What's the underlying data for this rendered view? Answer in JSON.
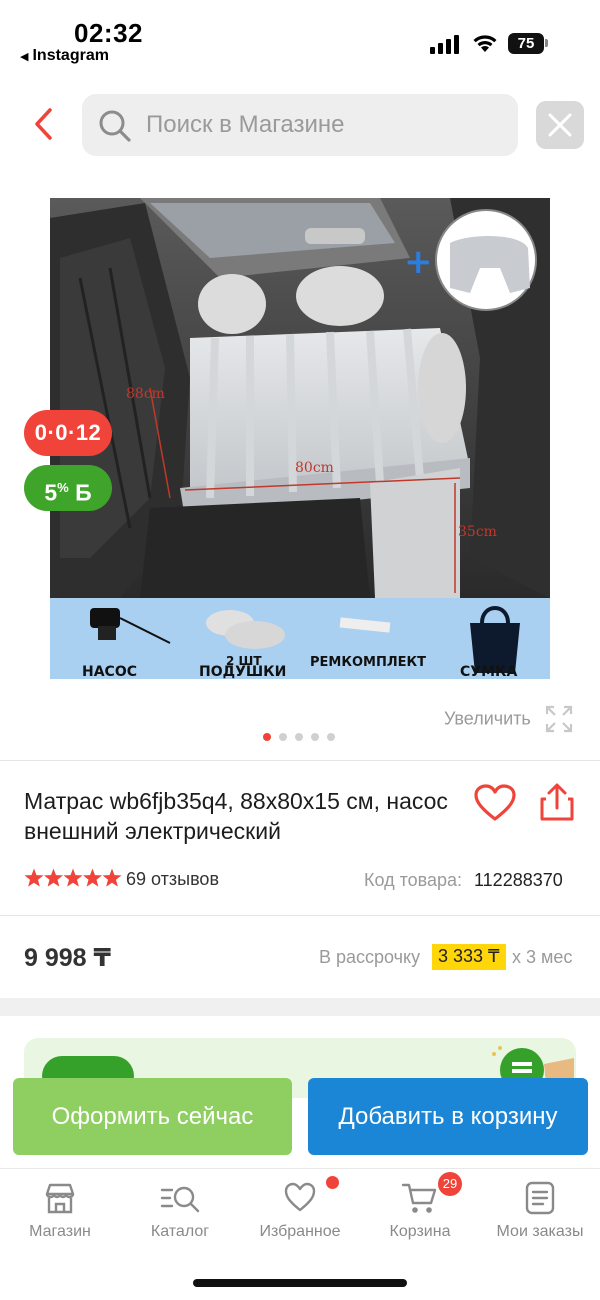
{
  "status_bar": {
    "time": "02:32",
    "back_app": "Instagram",
    "battery": "75"
  },
  "search": {
    "placeholder": "Поиск в Магазине"
  },
  "product": {
    "image_labels": {
      "dim_height": "88cm",
      "dim_width": "80cm",
      "dim_depth": "35cm",
      "item_pump": "НАСОС",
      "item_pillows_1": "2 ШТ",
      "item_pillows_2": "ПОДУШКИ",
      "item_repair": "РЕМКОМПЛЕКТ",
      "item_bag": "СУМКА"
    },
    "badge_installment": "0·0·12",
    "badge_bonus_pct": "5",
    "badge_bonus_sign": "%",
    "badge_bonus_cur": "Б",
    "zoom_label": "Увеличить",
    "title": "Матрас wb6fjb35q4, 88x80x15 см, насос внешний электрический",
    "rating": 5,
    "reviews": "69 отзывов",
    "sku_label": "Код товара:",
    "sku_value": "112288370",
    "price": "9 998 ₸",
    "installment_label": "В рассрочку",
    "installment_amount": "3 333 ₸",
    "installment_period": "х 3 мес",
    "gallery_count": 5,
    "gallery_active": 1
  },
  "actions": {
    "checkout": "Оформить сейчас",
    "add_to_cart": "Добавить в корзину"
  },
  "tabbar": {
    "items": [
      {
        "label": "Магазин",
        "icon": "store-icon"
      },
      {
        "label": "Каталог",
        "icon": "catalog-search-icon"
      },
      {
        "label": "Избранное",
        "icon": "heart-icon"
      },
      {
        "label": "Корзина",
        "icon": "cart-icon"
      },
      {
        "label": "Мои заказы",
        "icon": "orders-icon"
      }
    ],
    "cart_count": "29"
  },
  "colors": {
    "accent_red": "#f0433a",
    "checkout_green": "#8fcf62",
    "cart_blue": "#1b86d6",
    "bonus_green": "#3fa52a",
    "installment_yellow": "#ffd60a"
  }
}
